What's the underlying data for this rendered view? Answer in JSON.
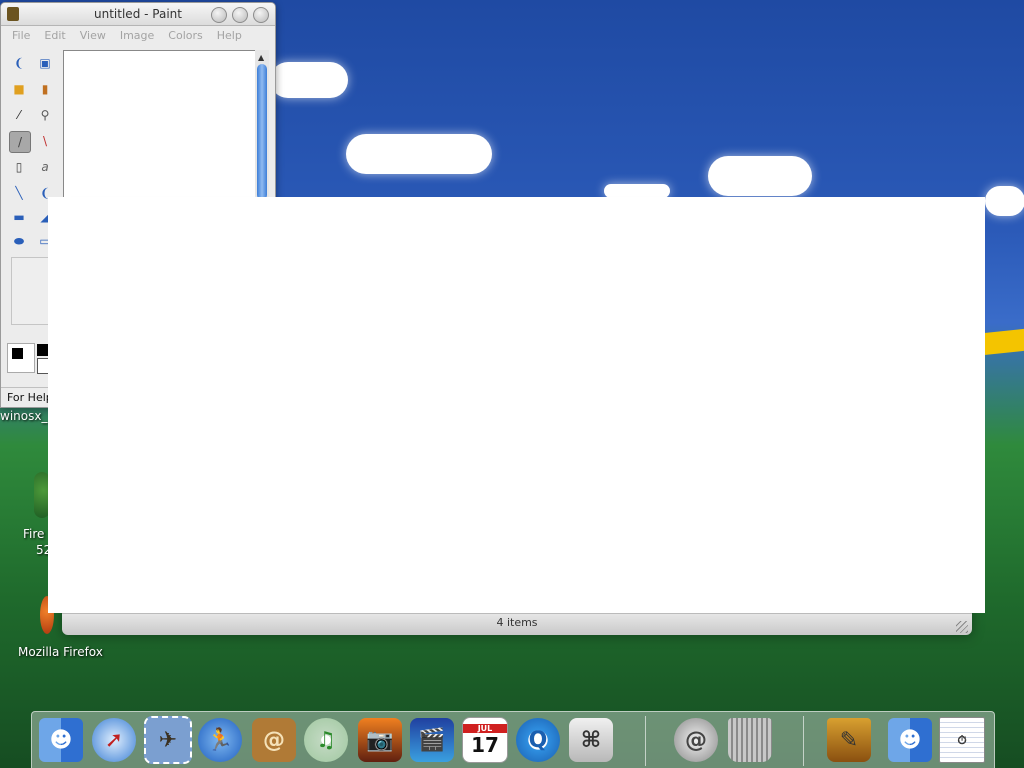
{
  "paint": {
    "title": "untitled - Paint",
    "menu": [
      "File",
      "Edit",
      "View",
      "Image",
      "Colors",
      "Help"
    ],
    "status": "For Help"
  },
  "desktop": {
    "icons": [
      {
        "label": "winosx_"
      },
      {
        "label": "Fire",
        "sublabel": "52"
      },
      {
        "label": "Mozilla Firefox"
      }
    ]
  },
  "finder": {
    "status": "4 items"
  },
  "dock": {
    "items": [
      {
        "icon": "finder-icon"
      },
      {
        "icon": "safari-icon"
      },
      {
        "icon": "mail-icon"
      },
      {
        "icon": "ichat-icon"
      },
      {
        "icon": "address-book-icon"
      },
      {
        "icon": "itunes-icon"
      },
      {
        "icon": "iphoto-icon"
      },
      {
        "icon": "imovie-icon"
      },
      {
        "icon": "ical-icon",
        "text": "17",
        "month": "JUL"
      },
      {
        "icon": "quicktime-icon"
      },
      {
        "icon": "system-preferences-icon"
      },
      {
        "icon": "mail-server-icon"
      },
      {
        "icon": "trash-icon"
      },
      {
        "icon": "pencil-cup-icon"
      },
      {
        "icon": "finder-icon-2"
      },
      {
        "icon": "window-thumbnail-icon"
      }
    ]
  },
  "colors": {
    "sky": "#2b5ab8",
    "grass": "#1f6a2c",
    "accent_yellow": "#f4c400"
  }
}
